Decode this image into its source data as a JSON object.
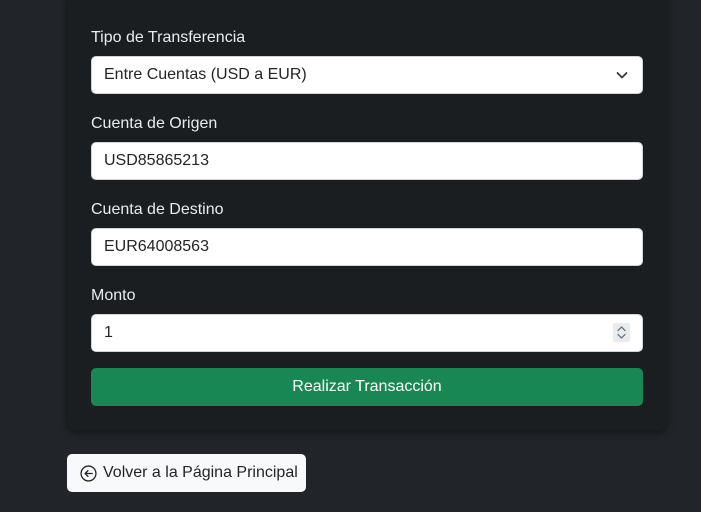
{
  "form": {
    "transfer_type": {
      "label": "Tipo de Transferencia",
      "selected": "Entre Cuentas (USD a EUR)"
    },
    "origin_account": {
      "label": "Cuenta de Origen",
      "value": "USD85865213"
    },
    "destination_account": {
      "label": "Cuenta de Destino",
      "value": "EUR64008563"
    },
    "amount": {
      "label": "Monto",
      "value": "1"
    },
    "submit_label": "Realizar Transacción"
  },
  "back_button": {
    "label": "Volver a la Página Principal",
    "icon": "arrow-left-circle-icon"
  },
  "colors": {
    "page_background": "#212529",
    "card_background": "#1b1e21",
    "primary_button": "#198754",
    "secondary_button": "#f8f9fa"
  }
}
